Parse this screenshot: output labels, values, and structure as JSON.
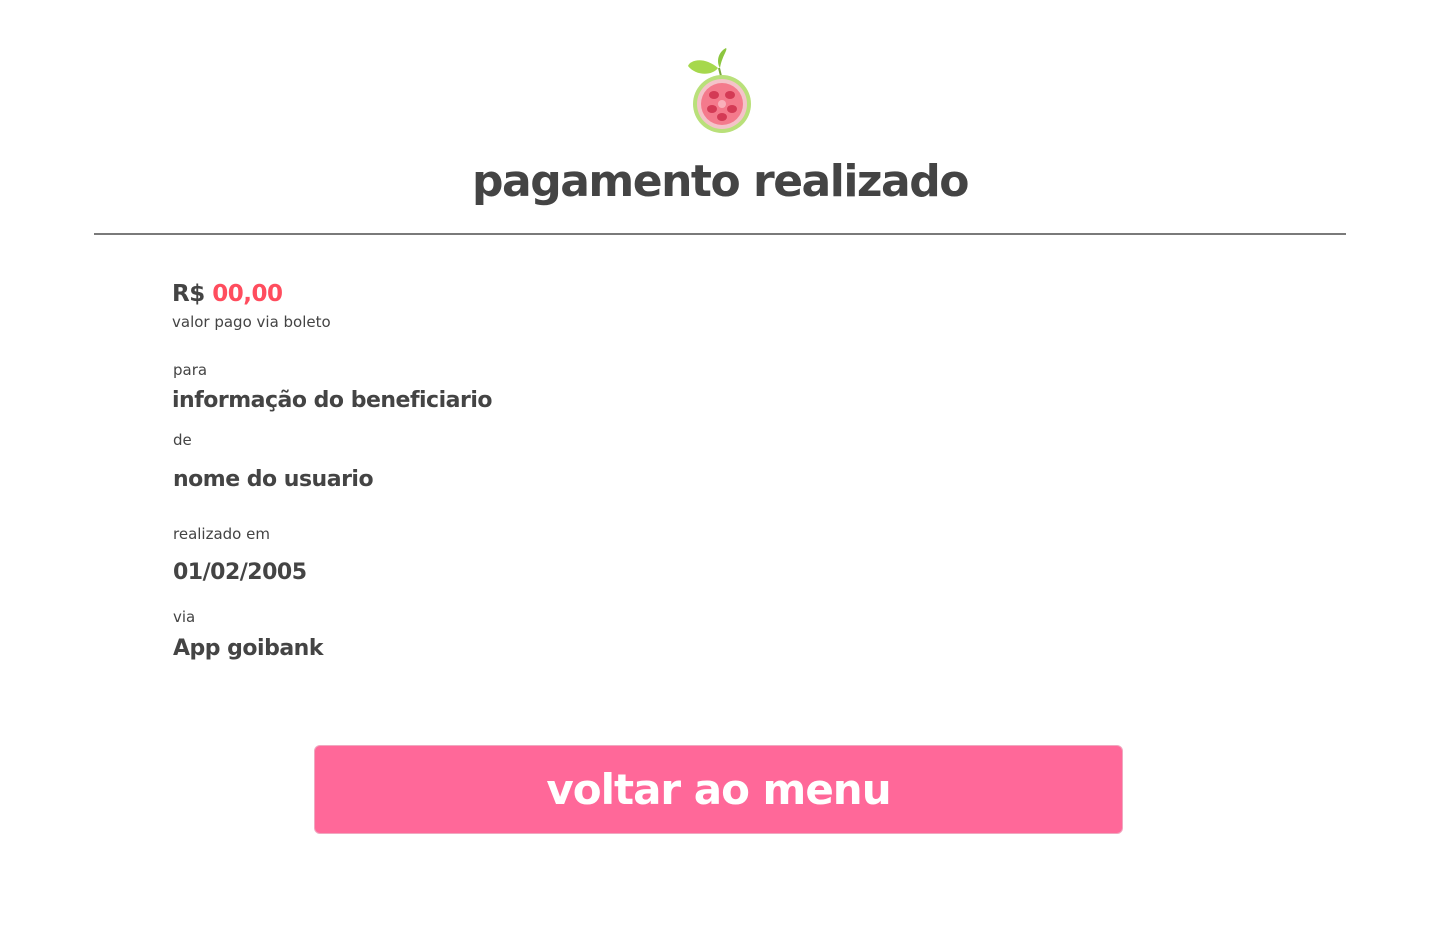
{
  "logo": {
    "icon": "guava-logo-icon",
    "colors": {
      "leaf": "#a6d84c",
      "rind": "#b9e07a",
      "flesh": "#f47a8c",
      "seeds": "#d43a55"
    }
  },
  "header": {
    "title": "pagamento realizado"
  },
  "payment": {
    "currency": "R$",
    "amount": "00,00",
    "amount_caption": "valor pago via boleto",
    "to_label": "para",
    "to_value": "informação do beneficiario",
    "from_label": "de",
    "from_value": "nome do usuario",
    "date_label": "realizado em",
    "date_value": "01/02/2005",
    "via_label": "via",
    "via_value": "App goibank"
  },
  "actions": {
    "back_label": "voltar ao menu"
  },
  "colors": {
    "accent": "#ff6899",
    "amount": "#ff4d5e",
    "text": "#444444"
  }
}
